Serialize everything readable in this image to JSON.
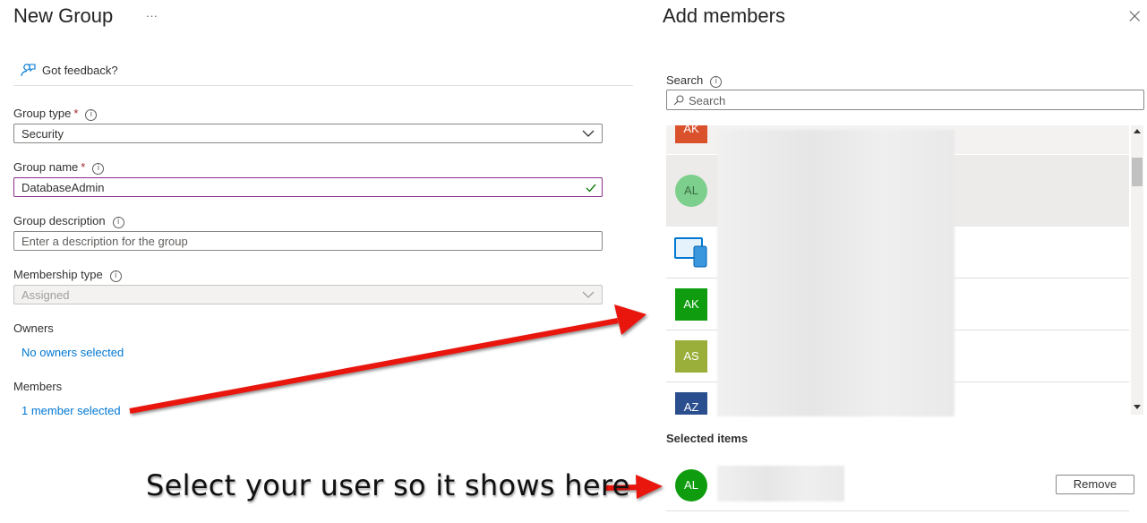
{
  "left": {
    "title": "New Group",
    "more": "···",
    "feedback": "Got feedback?",
    "group_type": {
      "label": "Group type",
      "required": "*",
      "value": "Security"
    },
    "group_name": {
      "label": "Group name",
      "required": "*",
      "value": "DatabaseAdmin"
    },
    "group_description": {
      "label": "Group description",
      "placeholder": "Enter a description for the group"
    },
    "membership_type": {
      "label": "Membership type",
      "value": "Assigned"
    },
    "owners": {
      "label": "Owners",
      "link": "No owners selected"
    },
    "members": {
      "label": "Members",
      "link": "1 member selected"
    }
  },
  "right": {
    "title": "Add members",
    "close": "×",
    "search": {
      "label": "Search",
      "placeholder": "Search"
    },
    "list": [
      {
        "initials": "AK",
        "color": "#d9522c"
      },
      {
        "initials": "AL",
        "color": "#7dcf8d"
      },
      {
        "initials": "",
        "color": "#0078d4",
        "icon": "device-icon"
      },
      {
        "initials": "AK",
        "color": "#0f9d0f"
      },
      {
        "initials": "AS",
        "color": "#9aaf3a"
      },
      {
        "initials": "AZ",
        "color": "#2b4f8e"
      }
    ],
    "selected_heading": "Selected items",
    "selected": {
      "initials": "AL",
      "color": "#0f9d0f",
      "remove_label": "Remove"
    }
  },
  "annotation": {
    "text": "Select your user so it shows here"
  }
}
